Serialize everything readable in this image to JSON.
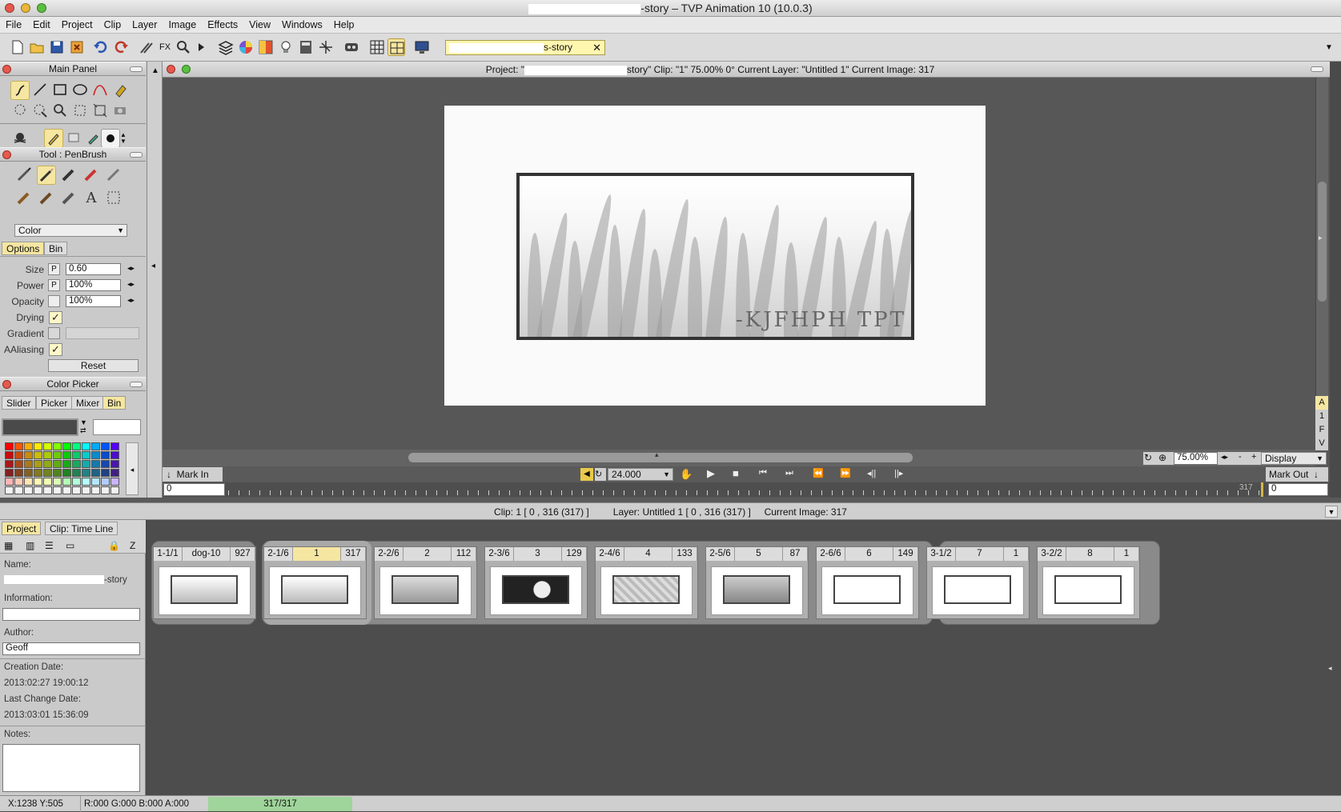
{
  "window": {
    "title_suffix": "-story – TVP Animation 10 (10.0.3)"
  },
  "menu": [
    "File",
    "Edit",
    "Project",
    "Clip",
    "Layer",
    "Image",
    "Effects",
    "View",
    "Windows",
    "Help"
  ],
  "project_tab": {
    "label": "s-story"
  },
  "main_panel": {
    "title": "Main Panel"
  },
  "tool_panel": {
    "title": "Tool : PenBrush",
    "mode": "Color",
    "tabs": [
      "Options",
      "Bin"
    ]
  },
  "options": {
    "size_label": "Size",
    "size_value": "0.60",
    "size_p": "P",
    "power_label": "Power",
    "power_value": "100%",
    "power_p": "P",
    "opacity_label": "Opacity",
    "opacity_value": "100%",
    "drying_label": "Drying",
    "gradient_label": "Gradient",
    "aaliasing_label": "AAliasing",
    "check": "✓",
    "reset": "Reset"
  },
  "color_picker": {
    "title": "Color Picker",
    "tabs": [
      "Slider",
      "Picker",
      "Mixer",
      "Bin"
    ]
  },
  "canvas_header": {
    "project_label": "Project:  \"",
    "rest": "story\"  Clip: \"1\"   75.00%   0°  Current Layer: \"Untitled 1\"  Current Image: 317"
  },
  "canvas_sketch": {
    "caption": "-KJFHPH  TPT"
  },
  "side_letters": [
    "A",
    "1",
    "F",
    "V"
  ],
  "zoom": {
    "value": "75.00%",
    "display": "Display"
  },
  "transport": {
    "mark_in": "Mark In",
    "mark_out": "Mark Out",
    "fps": "24.000"
  },
  "ruler": {
    "start": "0",
    "end_value": "0",
    "current": "317"
  },
  "status_mid": {
    "clip": "Clip: 1 [ 0 , 316  (317) ]",
    "layer": "Layer: Untitled 1 [ 0 , 316  (317) ]",
    "image": "Current Image: 317"
  },
  "bottom_tabs": [
    "Project",
    "Clip: Time Line"
  ],
  "project_info": {
    "name_label": "Name:",
    "name_value": "-story",
    "info_label": "Information:",
    "author_label": "Author:",
    "author_value": "Geoff",
    "created_label": "Creation Date:",
    "created_value": "2013:02:27 19:00:12",
    "changed_label": "Last Change Date:",
    "changed_value": "2013:03:01 15:36:09",
    "notes_label": "Notes:"
  },
  "clips": [
    {
      "pos": "1-1/1",
      "name": "dog-10",
      "count": "927"
    },
    {
      "pos": "2-1/6",
      "name": "1",
      "count": "317"
    },
    {
      "pos": "2-2/6",
      "name": "2",
      "count": "112"
    },
    {
      "pos": "2-3/6",
      "name": "3",
      "count": "129"
    },
    {
      "pos": "2-4/6",
      "name": "4",
      "count": "133"
    },
    {
      "pos": "2-5/6",
      "name": "5",
      "count": "87"
    },
    {
      "pos": "2-6/6",
      "name": "6",
      "count": "149"
    },
    {
      "pos": "3-1/2",
      "name": "7",
      "count": "1"
    },
    {
      "pos": "3-2/2",
      "name": "8",
      "count": "1"
    }
  ],
  "statusbar": {
    "coords": "X:1238  Y:505",
    "rgba": "R:000 G:000 B:000 A:000",
    "progress": "317/317"
  }
}
